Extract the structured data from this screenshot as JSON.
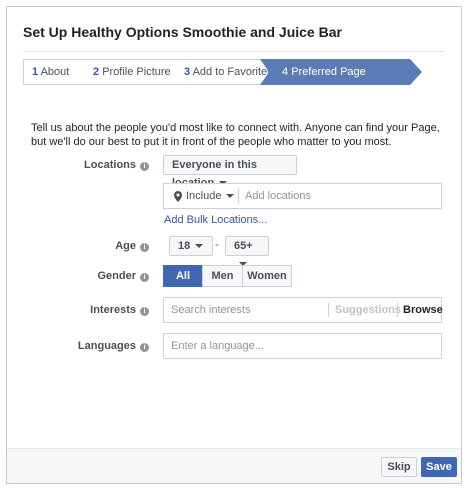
{
  "dialog": {
    "title": "Set Up Healthy Options Smoothie and Juice Bar"
  },
  "steps": [
    {
      "num": "1",
      "label": "About"
    },
    {
      "num": "2",
      "label": "Profile Picture"
    },
    {
      "num": "3",
      "label": "Add to Favorites"
    },
    {
      "num": "4",
      "label": "Preferred Page Audience"
    }
  ],
  "intro": "Tell us about the people you'd most like to connect with. Anyone can find your Page, but we'll do our best to put it in front of the people who matter to you most.",
  "locations": {
    "label": "Locations",
    "scope": "Everyone in this location",
    "include": "Include",
    "placeholder": "Add locations",
    "bulk_link": "Add Bulk Locations..."
  },
  "age": {
    "label": "Age",
    "min": "18",
    "separator": "-",
    "max": "65+"
  },
  "gender": {
    "label": "Gender",
    "options": [
      "All",
      "Men",
      "Women"
    ],
    "selected": "All"
  },
  "interests": {
    "label": "Interests",
    "placeholder": "Search interests",
    "suggestions": "Suggestions",
    "browse": "Browse"
  },
  "languages": {
    "label": "Languages",
    "placeholder": "Enter a language..."
  },
  "footer": {
    "skip": "Skip",
    "save": "Save"
  },
  "colors": {
    "primary": "#4267b2",
    "active_step": "#5b7bb5",
    "link": "#365899"
  }
}
